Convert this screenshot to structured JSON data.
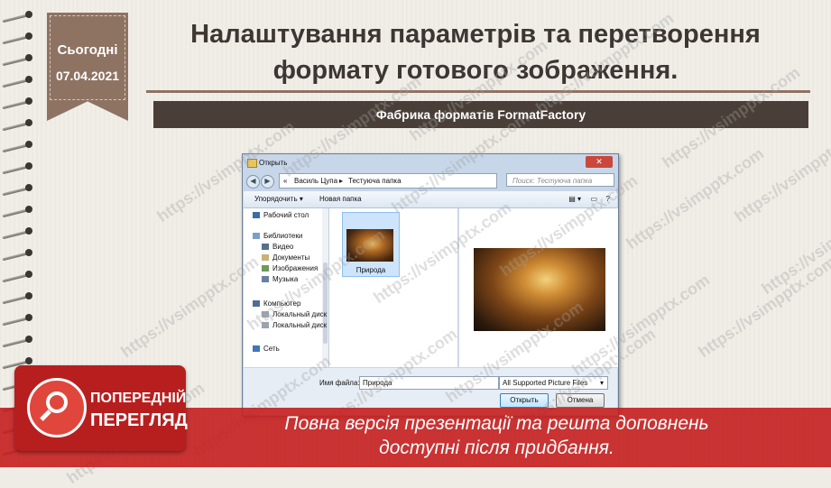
{
  "ribbon": {
    "label": "Сьогодні",
    "date": "07.04.2021"
  },
  "slide": {
    "title_line1": "Налаштування параметрів та перетворення",
    "title_line2": "формату готового зображення.",
    "subtitle": "Фабрика форматів FormatFactory"
  },
  "dialog": {
    "title": "Открыть",
    "close_symbol": "✕",
    "breadcrumb": [
      "Василь Цупа",
      "Тестуюча папка"
    ],
    "search_placeholder": "Поиск: Тестуюча папка",
    "toolbar": {
      "organize": "Упорядочить ▾",
      "new_folder": "Новая папка"
    },
    "nav_items": [
      {
        "label": "Рабочий стол",
        "icon": "desktop-icon"
      },
      {
        "label": "Библиотеки",
        "icon": "libraries-icon"
      },
      {
        "label": "Видео",
        "icon": "video-icon"
      },
      {
        "label": "Документы",
        "icon": "documents-icon"
      },
      {
        "label": "Изображения",
        "icon": "pictures-icon"
      },
      {
        "label": "Музыка",
        "icon": "music-icon"
      },
      {
        "label": "Компьютер",
        "icon": "computer-icon"
      },
      {
        "label": "Локальный диск",
        "icon": "drive-icon"
      },
      {
        "label": "Локальный диск",
        "icon": "drive-icon"
      },
      {
        "label": "Сеть",
        "icon": "network-icon"
      }
    ],
    "file_name": "Природа",
    "filename_label": "Имя файла:",
    "filename_value": "Природа",
    "filetype_value": "All Supported Picture Files",
    "open_button": "Открыть",
    "cancel_button": "Отмена"
  },
  "watermark": "https://vsimpptx.com",
  "banner": {
    "line1": "Повна версія презентації та решта доповнень",
    "line2": "доступні після придбання."
  },
  "badge": {
    "line1": "ПОПЕРЕДНІЙ",
    "line2": "ПЕРЕГЛЯД"
  },
  "colors": {
    "accent_brown": "#8e7363",
    "bar_dark": "#4a3f38",
    "banner_red": "#c41e1e"
  }
}
